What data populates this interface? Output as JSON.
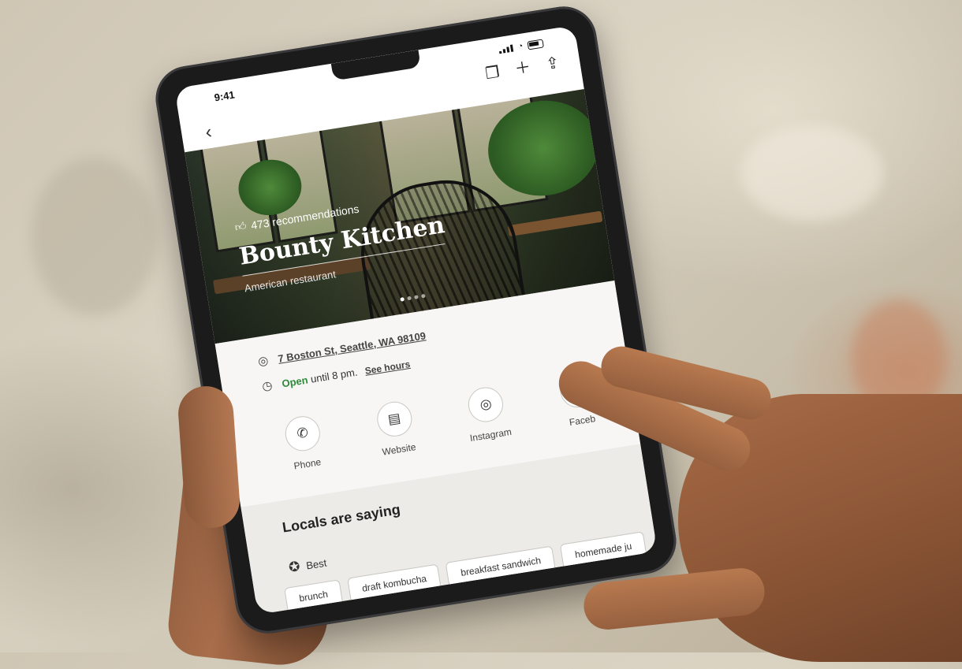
{
  "status": {
    "time": "9:41"
  },
  "header": {
    "back_icon": "chevron-left-icon",
    "actions": [
      "bookmark-icon",
      "plus-icon",
      "share-icon"
    ]
  },
  "hero": {
    "recommendations": "473 recommendations",
    "title": "Bounty Kitchen",
    "subtitle": "American restaurant",
    "carousel_dots": 4,
    "active_dot": 1
  },
  "info": {
    "address": "7 Boston St, Seattle, WA 98109",
    "open_status": "Open",
    "hours_text": "until 8 pm.",
    "hours_link": "See hours",
    "actions": [
      {
        "label": "Phone",
        "icon": "phone-icon"
      },
      {
        "label": "Website",
        "icon": "website-icon"
      },
      {
        "label": "Instagram",
        "icon": "instagram-icon"
      },
      {
        "label": "Faceb",
        "icon": "facebook-icon"
      }
    ],
    "open_color": "#2e8b3a"
  },
  "locals": {
    "heading": "Locals are saying",
    "best_label": "Best",
    "chips": [
      "brunch",
      "draft kombucha",
      "breakfast sandwich",
      "homemade ju"
    ]
  }
}
